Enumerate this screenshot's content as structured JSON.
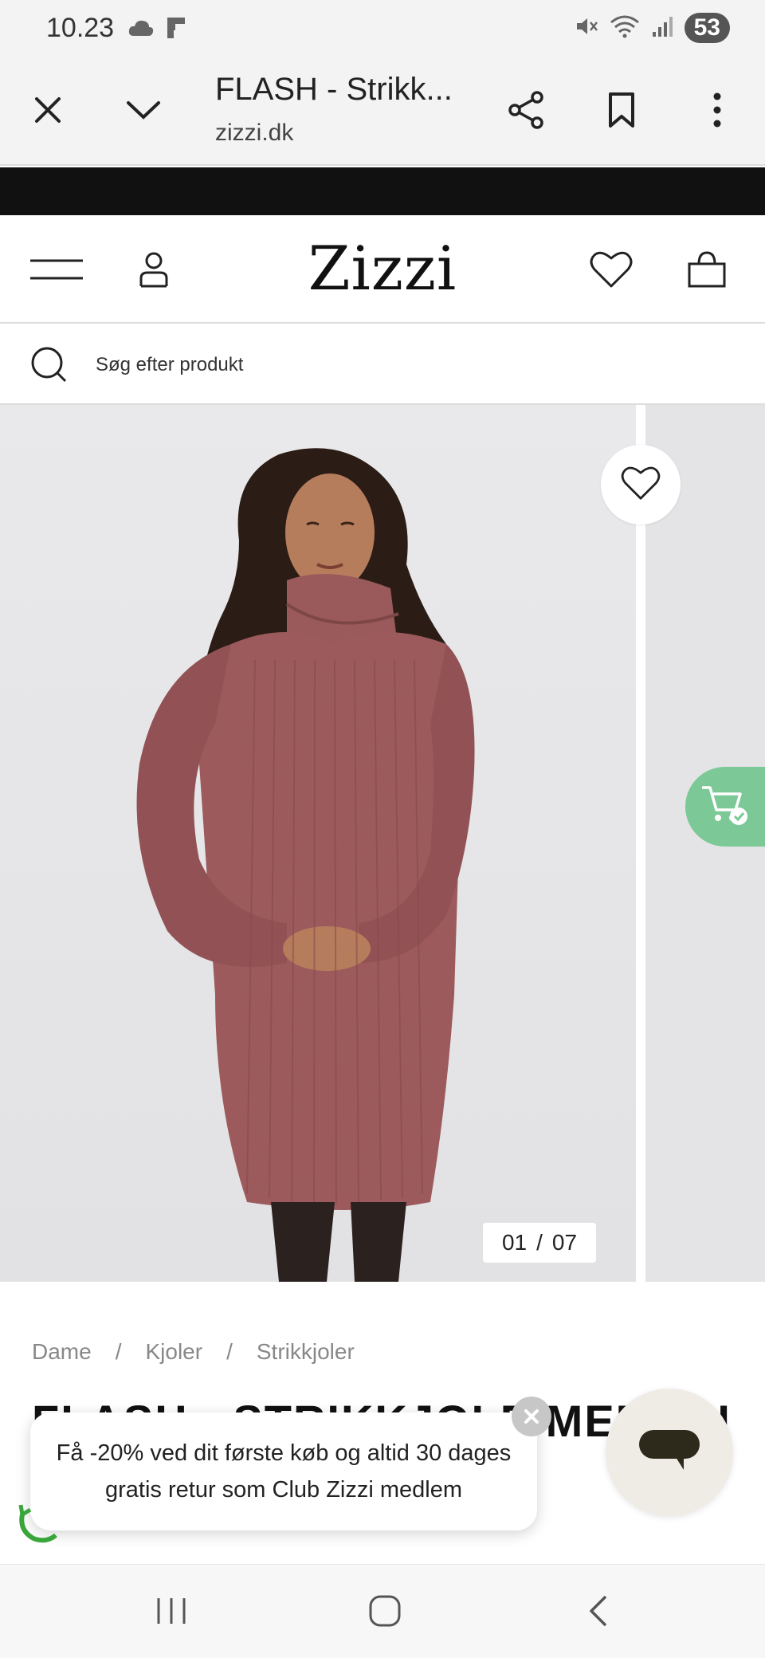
{
  "status_bar": {
    "time": "10.23",
    "battery": "53"
  },
  "browser": {
    "page_title": "FLASH - Strikk...",
    "url": "zizzi.dk"
  },
  "site": {
    "logo": "Zizzi",
    "search_placeholder": "Søg efter produkt"
  },
  "gallery": {
    "current": "01",
    "separator": "/",
    "total": "07"
  },
  "breadcrumb": {
    "items": [
      "Dame",
      "Kjoler",
      "Strikkjoler"
    ],
    "separator": "/"
  },
  "product": {
    "title": "FLASH - STRIKKJOLE MED RULLEKRAVE"
  },
  "promo_toast": {
    "message": "Få -20% ved dit første køb og altid 30 dages gratis retur som Club Zizzi medlem"
  },
  "colors": {
    "accent_green": "#7cc896",
    "sweater": "#9c5a5c",
    "header_black": "#111111"
  }
}
